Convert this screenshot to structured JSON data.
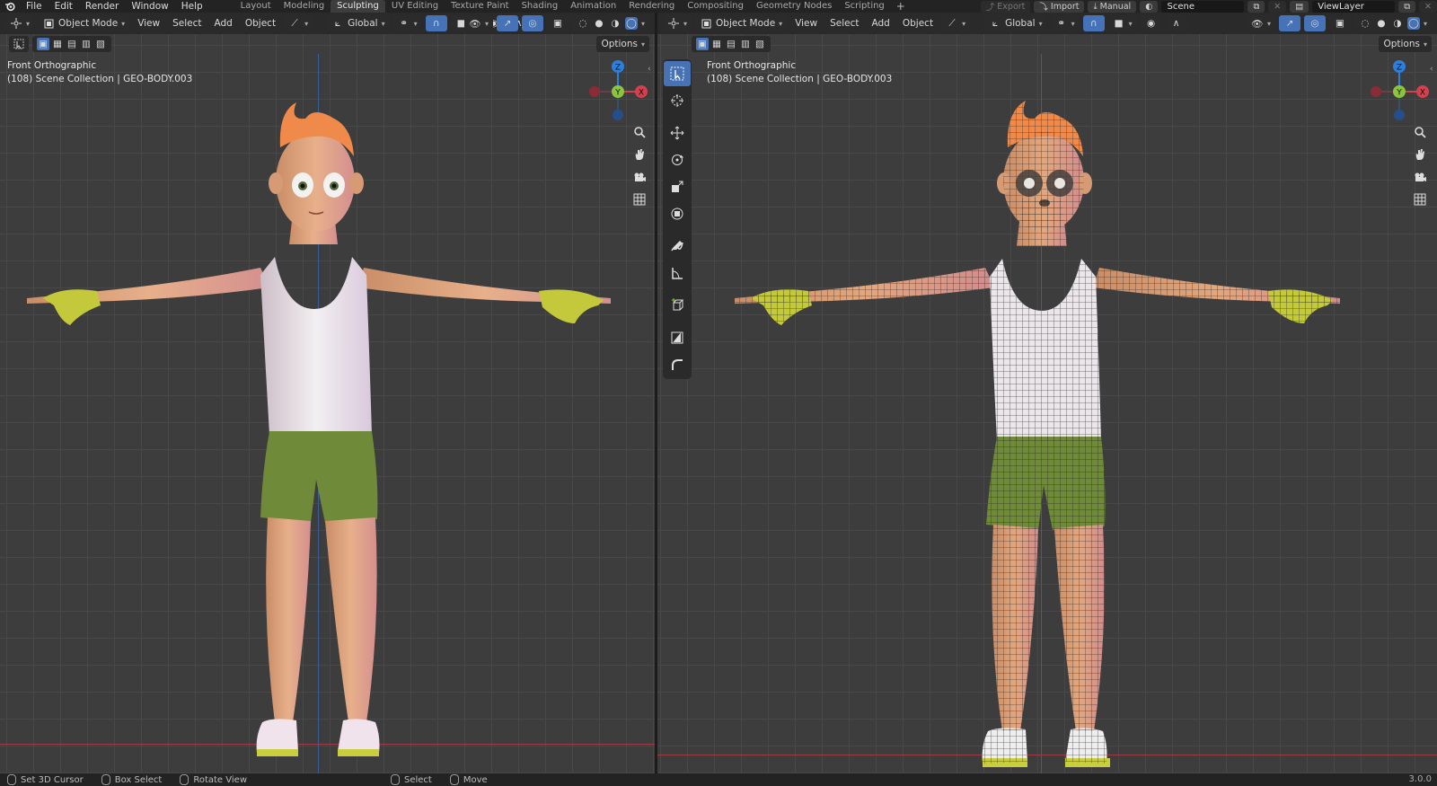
{
  "topbar": {
    "menus": [
      "File",
      "Edit",
      "Render",
      "Window",
      "Help"
    ],
    "workspaces": [
      "Layout",
      "Modeling",
      "Sculpting",
      "UV Editing",
      "Texture Paint",
      "Shading",
      "Animation",
      "Rendering",
      "Compositing",
      "Geometry Nodes",
      "Scripting"
    ],
    "active_workspace": "Sculpting",
    "add_workspace_symbol": "+",
    "export_label": "Export",
    "import_label": "Import",
    "manual_label": "Manual",
    "scene_label": "Scene",
    "view_layer_label": "ViewLayer"
  },
  "viewport_left": {
    "mode_label": "Object Mode",
    "menus": [
      "View",
      "Select",
      "Add",
      "Object"
    ],
    "orientation_label": "Global",
    "options_label": "Options",
    "view_name": "Front Orthographic",
    "collection_info": "(108) Scene Collection | GEO-BODY.003"
  },
  "viewport_right": {
    "mode_label": "Object Mode",
    "menus": [
      "View",
      "Select",
      "Add",
      "Object"
    ],
    "orientation_label": "Global",
    "options_label": "Options",
    "view_name": "Front Orthographic",
    "collection_info": "(108) Scene Collection | GEO-BODY.003"
  },
  "gizmo_axes": {
    "z": "Z",
    "y": "Y",
    "x": "X"
  },
  "statusbar": {
    "items": [
      "Set 3D Cursor",
      "Box Select",
      "Rotate View",
      "Select",
      "Move"
    ],
    "version": "3.0.0"
  },
  "colors": {
    "accent": "#4772b3",
    "x_axis": "#d3414f",
    "y_axis": "#8bc53f",
    "z_axis": "#2e7fd9",
    "skin": "#e0a77a",
    "hair": "#f08a4b",
    "shirt": "#eae9ea",
    "shorts": "#6f8a38",
    "gloves": "#c4cb3b"
  }
}
